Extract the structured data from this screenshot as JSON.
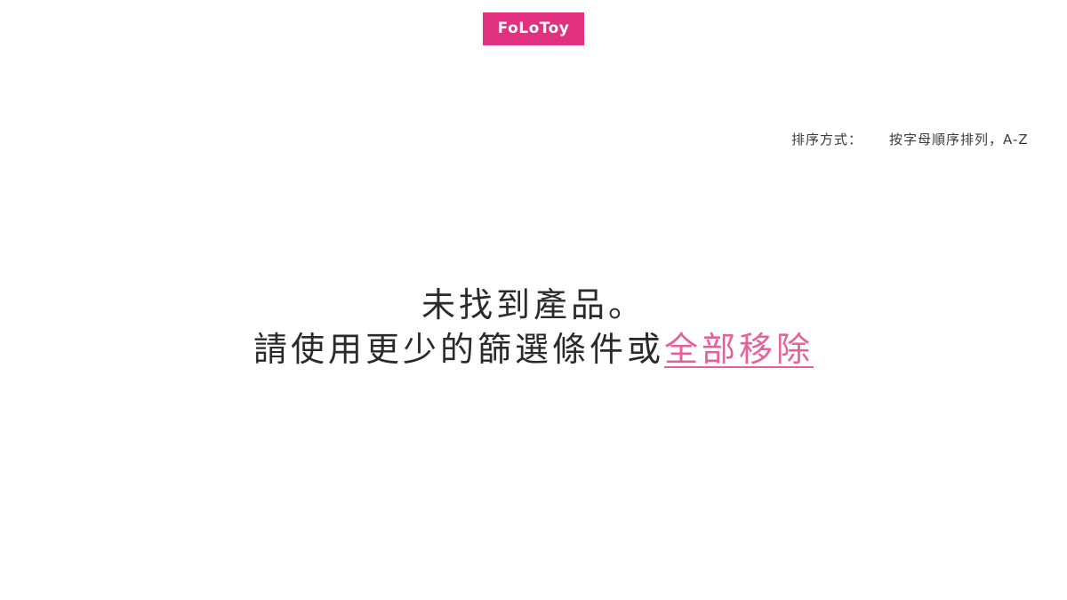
{
  "header": {
    "logo_text": "FoLoToy"
  },
  "sort": {
    "label": "排序方式：",
    "selected_option": "按字母順序排列，A-Z"
  },
  "empty_state": {
    "title": "未找到產品。",
    "message": "請使用更少的篩選條件或",
    "clear_link": "全部移除"
  },
  "colors": {
    "brand": "#e0307f",
    "link": "#e8609a"
  }
}
